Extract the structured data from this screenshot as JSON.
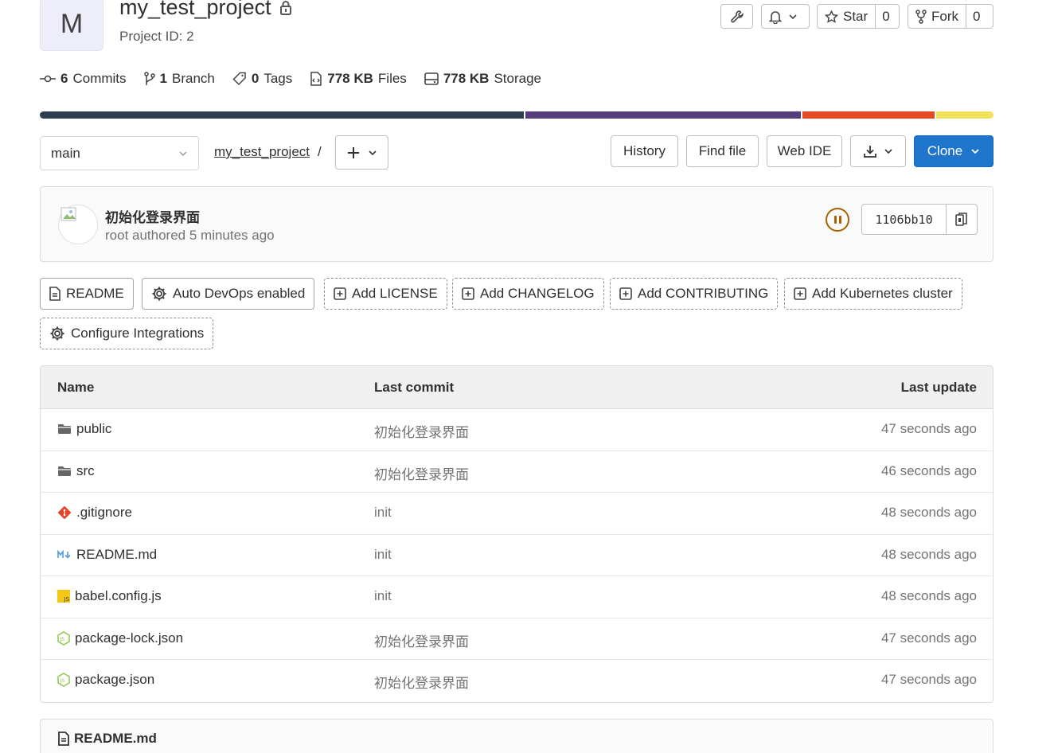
{
  "project": {
    "avatar_letter": "M",
    "name": "my_test_project",
    "id_label": "Project ID: 2"
  },
  "header_actions": {
    "star_label": "Star",
    "star_count": "0",
    "fork_label": "Fork",
    "fork_count": "0"
  },
  "stats": {
    "commits_num": "6",
    "commits_label": "Commits",
    "branch_num": "1",
    "branch_label": "Branch",
    "tags_num": "0",
    "tags_label": "Tags",
    "files_num": "778 KB",
    "files_label": "Files",
    "storage_num": "778 KB",
    "storage_label": "Storage"
  },
  "languages": [
    {
      "color": "#2c3e50",
      "share": 51
    },
    {
      "color": "#563d7c",
      "share": 29
    },
    {
      "color": "#e44b23",
      "share": 14
    },
    {
      "color": "#f1e05a",
      "share": 6
    }
  ],
  "toolbar": {
    "branch": "main",
    "breadcrumb": "my_test_project",
    "separator": "/",
    "history": "History",
    "find_file": "Find file",
    "web_ide": "Web IDE",
    "clone": "Clone"
  },
  "last_commit": {
    "title": "初始化登录界面",
    "meta": "root authored 5 minutes ago",
    "sha": "1106bb10"
  },
  "quick_actions": {
    "readme": "README",
    "auto_devops": "Auto DevOps enabled",
    "license": "Add LICENSE",
    "changelog": "Add CHANGELOG",
    "contributing": "Add CONTRIBUTING",
    "kubernetes": "Add Kubernetes cluster",
    "integrations": "Configure Integrations"
  },
  "table": {
    "headers": {
      "name": "Name",
      "last_commit": "Last commit",
      "last_update": "Last update"
    },
    "rows": [
      {
        "name": "public",
        "icon": "folder-icon",
        "commit": "初始化登录界面",
        "updated": "47 seconds ago"
      },
      {
        "name": "src",
        "icon": "folder-icon",
        "commit": "初始化登录界面",
        "updated": "46 seconds ago"
      },
      {
        "name": ".gitignore",
        "icon": "git-icon",
        "commit": "init",
        "updated": "48 seconds ago"
      },
      {
        "name": "README.md",
        "icon": "markdown-icon",
        "commit": "init",
        "updated": "48 seconds ago"
      },
      {
        "name": "babel.config.js",
        "icon": "javascript-icon",
        "commit": "init",
        "updated": "48 seconds ago"
      },
      {
        "name": "package-lock.json",
        "icon": "nodejs-icon",
        "commit": "初始化登录界面",
        "updated": "47 seconds ago"
      },
      {
        "name": "package.json",
        "icon": "nodejs-icon",
        "commit": "初始化登录界面",
        "updated": "47 seconds ago"
      }
    ]
  },
  "readme_section": {
    "title": "README.md"
  }
}
